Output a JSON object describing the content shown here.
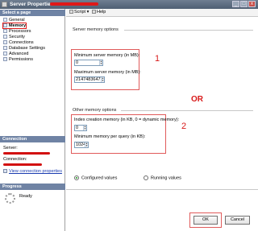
{
  "window": {
    "title": "Server Properties - ",
    "min": "_",
    "max": "□",
    "close": "x"
  },
  "left": {
    "select_page_header": "Select a page",
    "pages": [
      {
        "label": "General",
        "icon": "page-icon"
      },
      {
        "label": "Memory",
        "icon": "page-icon"
      },
      {
        "label": "Processors",
        "icon": "page-icon"
      },
      {
        "label": "Security",
        "icon": "page-icon"
      },
      {
        "label": "Connections",
        "icon": "page-icon"
      },
      {
        "label": "Database Settings",
        "icon": "page-icon"
      },
      {
        "label": "Advanced",
        "icon": "page-icon"
      },
      {
        "label": "Permissions",
        "icon": "page-icon"
      }
    ],
    "connection_header": "Connection",
    "server_label": "Server:",
    "connection_label": "Connection:",
    "view_connection_link": "View connection properties",
    "progress_header": "Progress",
    "progress_status": "Ready"
  },
  "toolbar": {
    "script": "Script",
    "help": "Help"
  },
  "main": {
    "server_memory_section": "Server memory options",
    "min_server_memory_label": "Minimum server memory (in MB):",
    "min_server_memory_value": "0",
    "max_server_memory_label": "Maximum server memory (in MB):",
    "max_server_memory_value": "2147483647",
    "other_memory_section": "Other memory options",
    "index_memory_label": "Index creation memory (in KB, 0 = dynamic memory):",
    "index_memory_value": "0",
    "min_query_memory_label": "Minimum memory per query (in KB):",
    "min_query_memory_value": "1024",
    "configured_values": "Configured values",
    "running_values": "Running values"
  },
  "annotations": {
    "one": "1",
    "two": "2",
    "or": "OR"
  },
  "buttons": {
    "ok": "OK",
    "cancel": "Cancel"
  },
  "colors": {
    "annotation_red": "#d81a1a",
    "header_blue": "#6f83a4"
  }
}
